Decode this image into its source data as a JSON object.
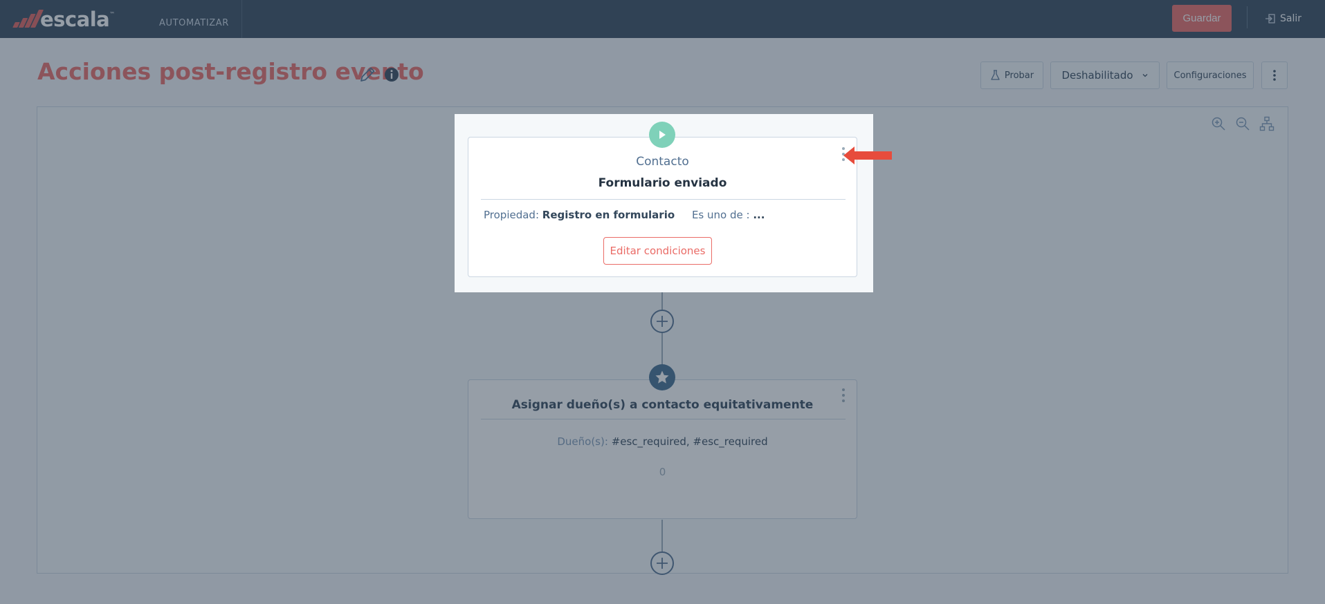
{
  "topbar": {
    "logo_text": "escala",
    "logo_tm": "™",
    "nav_label": "AUTOMATIZAR",
    "save_label": "Guardar",
    "exit_label": "Salir"
  },
  "page": {
    "title": "Acciones post-registro evento"
  },
  "toolbar": {
    "test_label": "Probar",
    "status_label": "Deshabilitado",
    "settings_label": "Configuraciones"
  },
  "trigger_card": {
    "object": "Contacto",
    "title": "Formulario enviado",
    "property_key": "Propiedad:",
    "property_value": "Registro en formulario",
    "operator": "Es uno de :",
    "operator_value": "...",
    "edit_label": "Editar condiciones"
  },
  "action_card": {
    "title": "Asignar dueño(s) a contacto equitativamente",
    "owners_key": "Dueño(s):",
    "owners_value": "#esc_required, #esc_required",
    "count": "0"
  },
  "colors": {
    "brand": "#ea6b66",
    "topbar": "#33475b",
    "trigger_icon": "#7fd1b9",
    "action_icon": "#3f6a8e"
  }
}
